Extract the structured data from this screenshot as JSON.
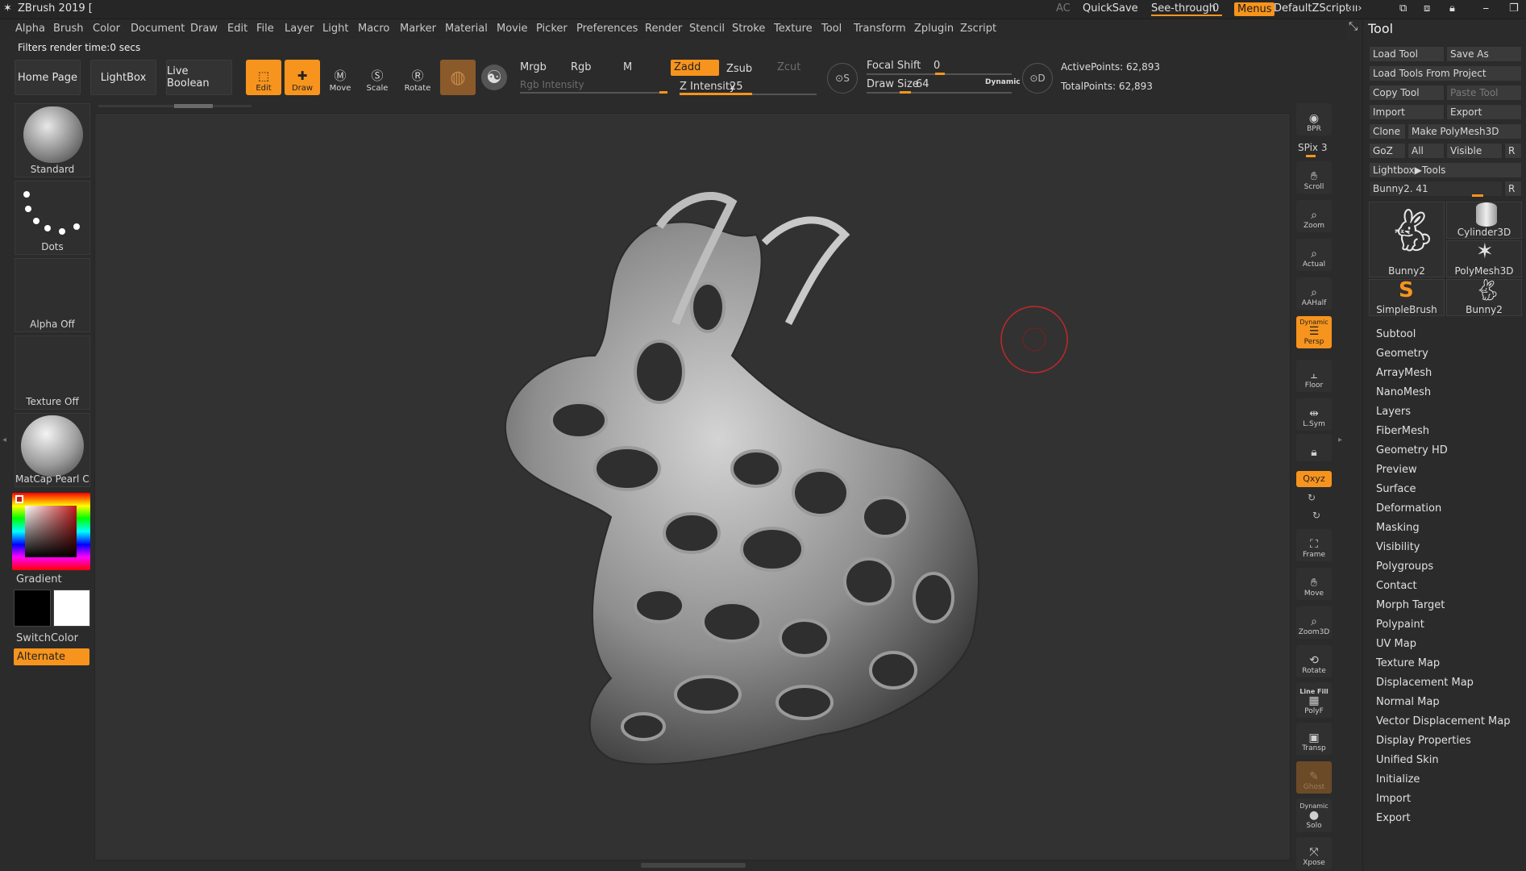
{
  "titlebar": {
    "app_title": "ZBrush 2019 [",
    "ac": "AC",
    "quicksave": "QuickSave",
    "see_through_label": "See-through",
    "see_through_value": "0",
    "menus": "Menus",
    "script": "DefaultZScript"
  },
  "menubar": [
    "Alpha",
    "Brush",
    "Color",
    "Document",
    "Draw",
    "Edit",
    "File",
    "Layer",
    "Light",
    "Macro",
    "Marker",
    "Material",
    "Movie",
    "Picker",
    "Preferences",
    "Render",
    "Stencil",
    "Stroke",
    "Texture",
    "Tool",
    "Transform",
    "Zplugin",
    "Zscript"
  ],
  "status": "Filters render time:0 secs",
  "shelf": {
    "home": "Home Page",
    "lightbox": "LightBox",
    "live_boolean": "Live Boolean",
    "edit": "Edit",
    "draw": "Draw",
    "move": "Move",
    "scale": "Scale",
    "rotate": "Rotate",
    "mrgb": "Mrgb",
    "rgb": "Rgb",
    "m": "M",
    "zadd": "Zadd",
    "zsub": "Zsub",
    "zcut": "Zcut",
    "rgb_intensity": "Rgb Intensity",
    "z_intensity_label": "Z Intensity",
    "z_intensity_value": "25",
    "focal_shift_label": "Focal Shift",
    "focal_shift_value": "0",
    "draw_size_label": "Draw Size",
    "draw_size_value": "64",
    "dynamic": "Dynamic",
    "active_points": "ActivePoints: 62,893",
    "total_points": "TotalPoints: 62,893"
  },
  "leftpanel": {
    "brush": "Standard",
    "stroke": "Dots",
    "alpha": "Alpha Off",
    "texture": "Texture Off",
    "material": "MatCap Pearl Ca",
    "gradient": "Gradient",
    "switchcolor": "SwitchColor",
    "alternate": "Alternate"
  },
  "rightcol": {
    "bpr": "BPR",
    "spix": "SPix 3",
    "scroll": "Scroll",
    "zoom": "Zoom",
    "actual": "Actual",
    "aahalf": "AAHalf",
    "dynamic": "Dynamic",
    "persp": "Persp",
    "floor": "Floor",
    "lsym": "L.Sym",
    "qxyz": "Qxyz",
    "frame": "Frame",
    "move": "Move",
    "zoom3d": "Zoom3D",
    "rotate": "Rotate",
    "linefill": "Line Fill",
    "polyf": "PolyF",
    "transp": "Transp",
    "ghost": "Ghost",
    "dynamic2": "Dynamic",
    "solo": "Solo",
    "xpose": "Xpose"
  },
  "toolpanel": {
    "title": "Tool",
    "load_tool": "Load Tool",
    "save_as": "Save As",
    "load_from_project": "Load Tools From Project",
    "copy_tool": "Copy Tool",
    "paste_tool": "Paste Tool",
    "import": "Import",
    "export": "Export",
    "clone": "Clone",
    "make_polymesh": "Make PolyMesh3D",
    "goz": "GoZ",
    "all": "All",
    "visible": "Visible",
    "r": "R",
    "lightbox_tools": "Lightbox▶Tools",
    "current_tool": "Bunny2. 41",
    "thumbs": [
      "Bunny2",
      "Cylinder3D",
      "PolyMesh3D",
      "SimpleBrush",
      "Bunny2"
    ],
    "subpalettes": [
      "Subtool",
      "Geometry",
      "ArrayMesh",
      "NanoMesh",
      "Layers",
      "FiberMesh",
      "Geometry HD",
      "Preview",
      "Surface",
      "Deformation",
      "Masking",
      "Visibility",
      "Polygroups",
      "Contact",
      "Morph Target",
      "Polypaint",
      "UV Map",
      "Texture Map",
      "Displacement Map",
      "Normal Map",
      "Vector Displacement Map",
      "Display Properties",
      "Unified Skin",
      "Initialize",
      "Import",
      "Export"
    ]
  },
  "colors": {
    "accent": "#f7941d",
    "bg": "#2b2b2b",
    "canvas": "#323232",
    "cursor_ring": "#c0282a"
  }
}
